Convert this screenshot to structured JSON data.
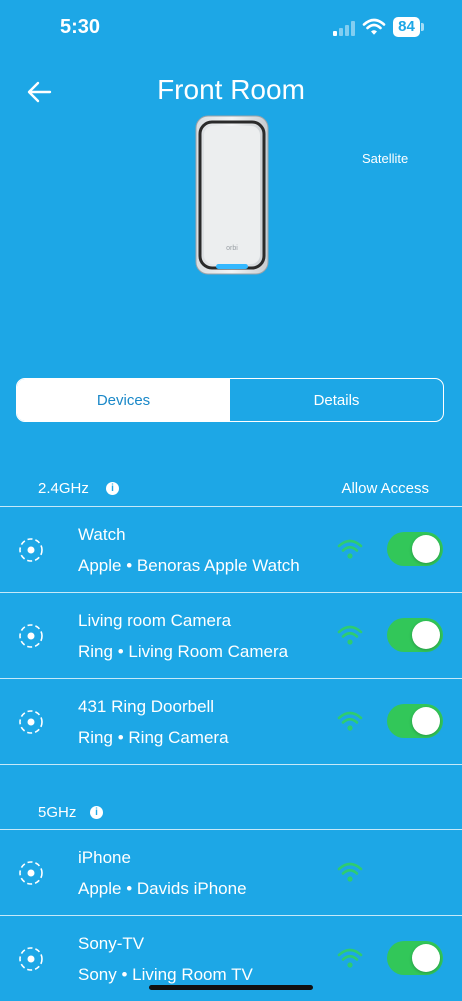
{
  "status_bar": {
    "time": "5:30",
    "battery": "84"
  },
  "header": {
    "title": "Front Room",
    "device_role": "Satellite"
  },
  "tabs": [
    {
      "label": "Devices",
      "active": true
    },
    {
      "label": "Details",
      "active": false
    }
  ],
  "sections": [
    {
      "title": "2.4GHz",
      "allow_access_label": "Allow Access",
      "devices": [
        {
          "name": "Watch",
          "brand": "Apple",
          "separator": "•",
          "description": "Benoras Apple Watch",
          "toggle": "on"
        },
        {
          "name": "Living room Camera",
          "brand": "Ring",
          "separator": "•",
          "description": "Living Room Camera",
          "toggle": "on"
        },
        {
          "name": "431 Ring Doorbell",
          "brand": "Ring",
          "separator": "•",
          "description": "Ring Camera",
          "toggle": "on"
        }
      ]
    },
    {
      "title": "5GHz",
      "devices": [
        {
          "name": "iPhone",
          "brand": "Apple",
          "separator": "•",
          "description": "Davids iPhone"
        },
        {
          "name": "Sony-TV",
          "brand": "Sony",
          "separator": "•",
          "description": "Living Room TV",
          "toggle": "on"
        }
      ]
    }
  ],
  "colors": {
    "background": "#1da7e6",
    "toggle_on": "#32c759",
    "wifi_signal": "#2ecc71",
    "active_tab_text": "#1a88c8"
  }
}
